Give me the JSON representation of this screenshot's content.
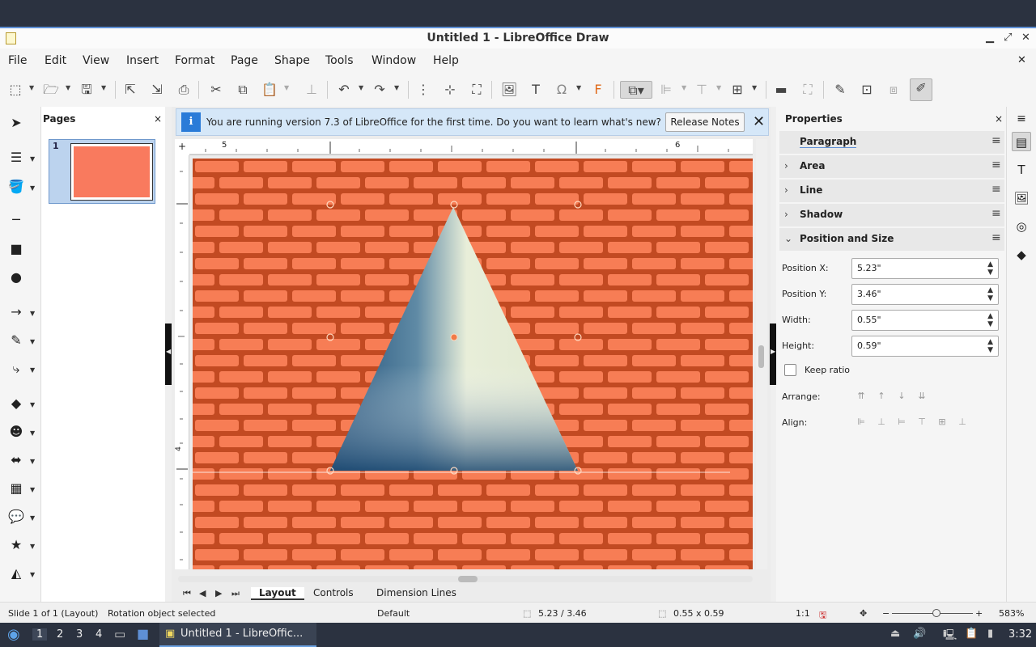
{
  "window": {
    "title": "Untitled 1 - LibreOffice Draw",
    "minimize_glyph": "▁",
    "restore_glyph": "⤢",
    "close_glyph": "✕",
    "doc_close_glyph": "✕"
  },
  "menu": [
    "File",
    "Edit",
    "View",
    "Insert",
    "Format",
    "Page",
    "Shape",
    "Tools",
    "Window",
    "Help"
  ],
  "pages_pane": {
    "title": "Pages",
    "close_glyph": "×",
    "slides": [
      {
        "number": "1",
        "color": "#f97a5e"
      }
    ]
  },
  "infobar": {
    "message": "You are running version 7.3 of LibreOffice for the first time. Do you want to learn what's new?",
    "button": "Release Notes",
    "close_glyph": "✕"
  },
  "rulers": {
    "h_labels": [
      "5",
      "6"
    ],
    "v_labels": [
      "4"
    ]
  },
  "tabs": [
    "Layout",
    "Controls",
    "Dimension Lines"
  ],
  "properties": {
    "title": "Properties",
    "close_glyph": "×",
    "sections": [
      {
        "label": "Paragraph",
        "expanded": false
      },
      {
        "label": "Area",
        "expanded": false
      },
      {
        "label": "Line",
        "expanded": false
      },
      {
        "label": "Shadow",
        "expanded": false
      },
      {
        "label": "Position and Size",
        "expanded": true
      }
    ],
    "position_x_label": "Position X:",
    "position_x": "5.23\"",
    "position_y_label": "Position Y:",
    "position_y": "3.46\"",
    "width_label": "Width:",
    "width": "0.55\"",
    "height_label": "Height:",
    "height": "0.59\"",
    "keep_ratio": "Keep ratio",
    "arrange": "Arrange:",
    "align": "Align:"
  },
  "status": {
    "slide": "Slide 1 of 1 (Layout)",
    "selection": "Rotation object selected",
    "style": "Default",
    "position": "5.23 / 3.46",
    "size": "0.55 x 0.59",
    "scale": "1:1",
    "zoom": "583%"
  },
  "taskbar": {
    "workspaces": [
      "1",
      "2",
      "3",
      "4"
    ],
    "app_title": "Untitled 1 - LibreOffic...",
    "clock": "3:32"
  },
  "colors": {
    "accent": "#5e8fd5",
    "brick": "#d75a2c",
    "slide_thumb": "#f97a5e"
  }
}
